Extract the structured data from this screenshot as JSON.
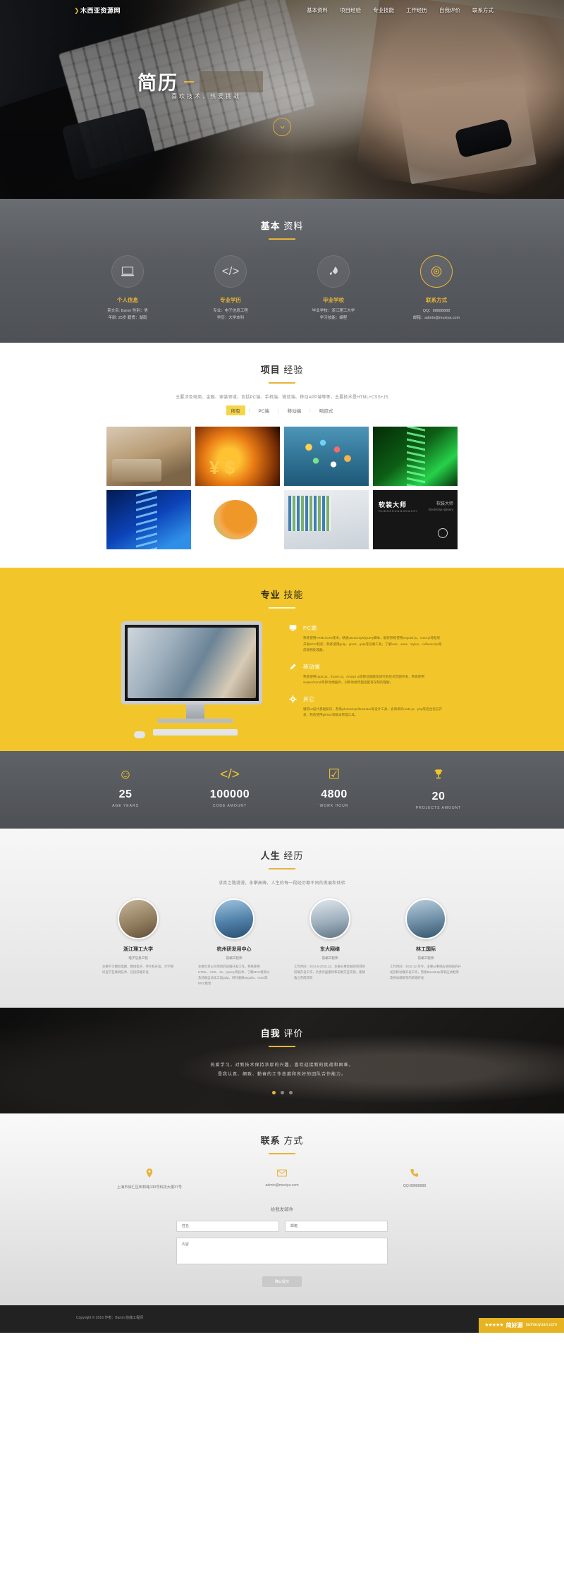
{
  "nav": {
    "brand": "木西亚资源网",
    "brand_arrow": "❯",
    "links": [
      {
        "label": "基本资料"
      },
      {
        "label": "项目经验"
      },
      {
        "label": "专业技能"
      },
      {
        "label": "工作经历"
      },
      {
        "label": "自我评价"
      },
      {
        "label": "联系方式"
      }
    ]
  },
  "hero": {
    "title": "简历",
    "subtitle": "喜欢技术，热爱挑战",
    "scroll_icon": "❯"
  },
  "basic": {
    "title_bold": "基本",
    "title_light": "资料",
    "cards": [
      {
        "icon": "laptop-icon",
        "glyph": "▭",
        "title": "个人信息",
        "line1": "英文名: Baron  性别：男",
        "line2": "年龄: 25岁  籍贯：湖南"
      },
      {
        "icon": "code-icon",
        "glyph": "</>",
        "title": "专业学历",
        "line1": "专业：电子信息工程",
        "line2": "学历：大学本科"
      },
      {
        "icon": "rocket-icon",
        "glyph": "🚀",
        "title": "毕业学校",
        "line1": "毕业学校：浙江理工大学",
        "line2": "学习技能：编程"
      },
      {
        "icon": "target-icon",
        "glyph": "◎",
        "title": "联系方式",
        "line1": "QQ：88888888",
        "line2": "邮箱：admin@muxiya.com"
      }
    ]
  },
  "projects": {
    "title_bold": "项目",
    "title_light": "经验",
    "description": "主要涉及电商、金融、家装领域，包括PC端、手机端、微信端、移动APP端等等，主要技术是HTML+CSS+JS",
    "filters": [
      {
        "label": "所有",
        "active": true
      },
      {
        "label": "PC端",
        "active": false
      },
      {
        "label": "移动端",
        "active": false
      },
      {
        "label": "响应式",
        "active": false
      }
    ],
    "tiles": [
      {
        "name": "home-interior-project"
      },
      {
        "name": "finance-currency-project"
      },
      {
        "name": "social-network-project"
      },
      {
        "name": "dna-green-project"
      },
      {
        "name": "dna-blue-project"
      },
      {
        "name": "ued-design-project"
      },
      {
        "name": "bookshelf-office-project"
      },
      {
        "name": "soft-decoration-project",
        "caption": "软装大师",
        "caption_sub": "RUANZHUANGDASHI",
        "right_title": "软装大师",
        "right_sub": "Bootstrap+jQuery"
      }
    ]
  },
  "skills": {
    "title_bold": "专业",
    "title_light": "技能",
    "items": [
      {
        "icon": "desktop-icon",
        "glyph": "🖥",
        "name": "PC端",
        "text": "熟练使用HTML/CSS技术，精通Javascript/jQuery脚本，能较熟练使用angular.js，react.js等框架开发MVC程序，熟练使用gulp、grunt、gulp等前端工具，了解less、sass、stylus、coffeescript等前端预处理器。"
      },
      {
        "icon": "mobile-icon",
        "glyph": "✎",
        "name": "移动端",
        "text": "熟练使用zepto.js、frozen ui、Amaze ui等移动端框架进行响应式页面开发，熟练使用swiper/iscroll等移动端插件，对移动端页面适配有深刻的理解。"
      },
      {
        "icon": "more-icon",
        "glyph": "⚙",
        "name": "其它",
        "text": "懂得UI设计基础知识，熟悉photoshop/illustrator等设计工具，会简单的node.js、php等后台语言开发，熟悉使用git/svn等版本管理工具。"
      }
    ]
  },
  "stats": [
    {
      "icon": "smile-icon",
      "glyph": "☺",
      "value": "25",
      "label": "AGE YEARS"
    },
    {
      "icon": "code-icon",
      "glyph": "</>",
      "value": "100000",
      "label": "CODE AMOUNT"
    },
    {
      "icon": "check-icon",
      "glyph": "☑",
      "value": "4800",
      "label": "WORK HOUR"
    },
    {
      "icon": "trophy-icon",
      "glyph": "🏆",
      "value": "20",
      "label": "PROJECTS AMOUNT"
    }
  ],
  "life": {
    "title_bold": "人生",
    "title_light": "经历",
    "description": "求真之路漫漫，永攀高峰，人生的每一段经历都不同的发展和体验",
    "cards": [
      {
        "photo": "zhejiang-university-photo",
        "name": "浙江理工大学",
        "meta": "电子信息工程",
        "text": "主要学习模拟电路、数组电子、单片机开发，大学期间自学互联网技术，包括前端开发"
      },
      {
        "photo": "hangzhou-company-photo",
        "name": "杭州研发用中心",
        "meta": "前端工程师",
        "text": "主要负责公司项目的前端开发工作，熟练使用HTML、CSS、JS、jQuery等技术，了解MVC框架以及前端自动化工具gulp，同时兼顾angular、react等MVC框架"
      },
      {
        "photo": "east-china-net-photo",
        "name": "东大网络",
        "meta": "前端工程师",
        "text": "工作时间：2014.5-2015.12，主要从事金融的项目的前端开发工作，负责页面重构和前端交互实现，能够独立完成项目"
      },
      {
        "photo": "linwang-international-photo",
        "name": "林工国际",
        "meta": "前端工程师",
        "text": "工作时间：2015.12-至今，主要从事响应式网站的开发及移动端开发工作，熟悉Bootstrap等响应式框架及移动端框架的前端开发"
      }
    ]
  },
  "review": {
    "title_bold": "自我",
    "title_light": "评价",
    "quote_line1": "热爱学习，对新技术保持浓厚的兴趣，喜欢迎接新的挑战和困难，",
    "quote_line2": "是我认真、细致、勤奋的工作态度和良好的团队合作能力。",
    "dots": 3,
    "active_dot": 0
  },
  "contact": {
    "title_bold": "联系",
    "title_light": "方式",
    "items": [
      {
        "icon": "location-icon",
        "glyph": "📍",
        "text": "上海市徐汇区田林路130号科技大厦37号"
      },
      {
        "icon": "mail-icon",
        "glyph": "✉",
        "text": "admin@muxiya.com"
      },
      {
        "icon": "phone-icon",
        "glyph": "📞",
        "text": "QQ:88888888"
      }
    ],
    "form": {
      "heading": "给我发邮件",
      "name_placeholder": "姓名",
      "email_placeholder": "邮箱",
      "message_placeholder": "内容",
      "submit_label": "确认提交"
    }
  },
  "footer": {
    "copyright": "Copyright © 2016 作者：Baron 前端工程师",
    "badge": {
      "stars": "★★★★★",
      "title": "简好源",
      "url": "taohaoyuan.com"
    }
  }
}
